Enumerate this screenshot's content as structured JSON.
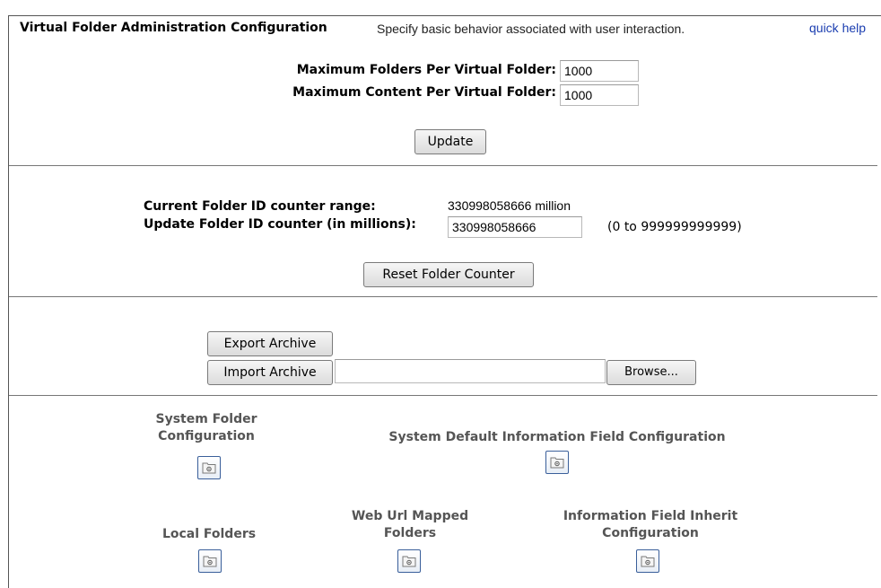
{
  "header": {
    "title": "Virtual Folder Administration Configuration",
    "description": "Specify basic behavior associated with user interaction.",
    "quick_help": "quick help"
  },
  "limits": {
    "max_folders_label": "Maximum Folders Per Virtual Folder:",
    "max_folders_value": "1000",
    "max_content_label": "Maximum Content Per Virtual Folder:",
    "max_content_value": "1000",
    "update_button": "Update"
  },
  "counter": {
    "current_range_label": "Current Folder ID counter range:",
    "current_range_value": "330998058666 million",
    "update_label": "Update Folder ID counter (in millions):",
    "update_value": "330998058666",
    "range_hint": "(0 to 999999999999)",
    "reset_button": "Reset Folder Counter"
  },
  "archive": {
    "export_button": "Export Archive",
    "import_button": "Import Archive",
    "file_value": "",
    "browse_button": "Browse..."
  },
  "configs": {
    "system_folder": "System Folder Configuration",
    "system_default_info": "System Default Information Field Configuration",
    "local_folders": "Local Folders",
    "web_url_mapped": "Web Url Mapped Folders",
    "info_field_inherit": "Information Field Inherit Configuration"
  },
  "icons": {
    "folder_config": "folder-gear-icon"
  }
}
